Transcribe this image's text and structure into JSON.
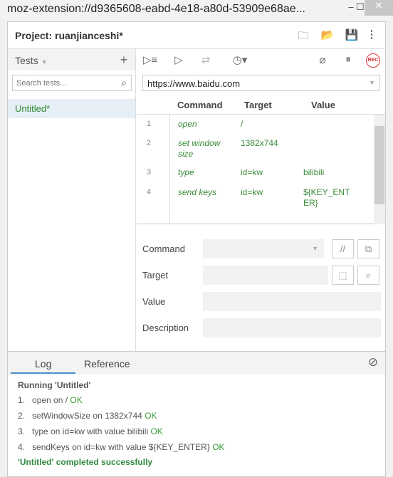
{
  "window": {
    "title": "moz-extension://d9365608-eabd-4e18-a80d-53909e68ae..."
  },
  "project": {
    "label": "Project:  ruanjianceshi*"
  },
  "tests": {
    "header": "Tests",
    "search_placeholder": "Search tests...",
    "items": [
      {
        "name": "Untitled*"
      }
    ]
  },
  "toolbar": {
    "url": "https://www.baidu.com"
  },
  "table": {
    "headers": [
      "Command",
      "Target",
      "Value"
    ],
    "rows": [
      {
        "n": "1",
        "command": "open",
        "target": "/",
        "value": ""
      },
      {
        "n": "2",
        "command": "set window size",
        "target": "1382x744",
        "value": ""
      },
      {
        "n": "3",
        "command": "type",
        "target": "id=kw",
        "value": "bilibili"
      },
      {
        "n": "4",
        "command": "send keys",
        "target": "id=kw",
        "value": "${KEY_ENTER}"
      }
    ]
  },
  "editor": {
    "command": "Command",
    "target": "Target",
    "value": "Value",
    "description": "Description"
  },
  "log": {
    "tabs": [
      "Log",
      "Reference"
    ],
    "running": "Running 'Untitled'",
    "lines": [
      {
        "num": "1.",
        "text": "open on /",
        "status": "OK"
      },
      {
        "num": "2.",
        "text": "setWindowSize on 1382x744",
        "status": "OK"
      },
      {
        "num": "3.",
        "text": "type on id=kw with value bilibili",
        "status": "OK"
      },
      {
        "num": "4.",
        "text": "sendKeys on id=kw with value ${KEY_ENTER}",
        "status": "OK"
      }
    ],
    "done": "'Untitled' completed successfully"
  },
  "colors": {
    "ok": "#3a9a3a",
    "rec": "#d33",
    "accent": "#4a90c8"
  }
}
